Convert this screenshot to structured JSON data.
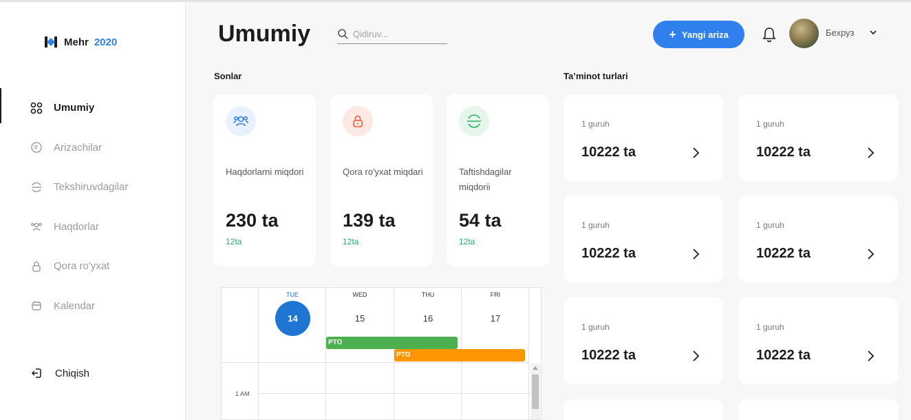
{
  "brand": {
    "name": "Mehr",
    "year": "2020"
  },
  "sidebar": {
    "items": [
      {
        "label": "Umumiy",
        "icon": "grid-icon"
      },
      {
        "label": "Arizachilar",
        "icon": "document-icon"
      },
      {
        "label": "Tekshiruvdagilar",
        "icon": "scan-icon"
      },
      {
        "label": "Haqdorlar",
        "icon": "users-icon"
      },
      {
        "label": "Qora ro'yxat",
        "icon": "lock-icon"
      },
      {
        "label": "Kalendar",
        "icon": "calendar-icon"
      }
    ],
    "logout_label": "Chiqish"
  },
  "header": {
    "title": "Umumiy",
    "search_placeholder": "Qidiruv...",
    "new_button_label": "Yangi ariza",
    "user_name": "Бехруз"
  },
  "stats": {
    "section_label": "Sonlar",
    "cards": [
      {
        "label": "Haqdorlarni miqdori",
        "value": "230 ta",
        "sub": "12ta",
        "icon": "users-icon",
        "icon_color": "#2f80ed",
        "icon_bg": "#e8f1fd"
      },
      {
        "label": "Qora ro'yxat miqdari",
        "value": "139 ta",
        "sub": "12ta",
        "icon": "lock-icon",
        "icon_color": "#eb5a3c",
        "icon_bg": "#fde9e4"
      },
      {
        "label": "Taftishdagilar miqdorii",
        "value": "54 ta",
        "sub": "12ta",
        "icon": "scan-icon",
        "icon_color": "#27ae60",
        "icon_bg": "#e6f6ec"
      }
    ]
  },
  "provisions": {
    "section_label": "Ta’minot turlari",
    "cards": [
      {
        "group": "1 guruh",
        "value": "10222 ta"
      },
      {
        "group": "1 guruh",
        "value": "10222 ta"
      },
      {
        "group": "1 guruh",
        "value": "10222 ta"
      },
      {
        "group": "1 guruh",
        "value": "10222 ta"
      },
      {
        "group": "1 guruh",
        "value": "10222 ta"
      },
      {
        "group": "1 guruh",
        "value": "10222 ta"
      }
    ]
  },
  "calendar": {
    "days": [
      {
        "name": "TUE",
        "date": "14",
        "today": true
      },
      {
        "name": "WED",
        "date": "15"
      },
      {
        "name": "THU",
        "date": "16"
      },
      {
        "name": "FRI",
        "date": "17"
      }
    ],
    "events": [
      {
        "label": "PTO",
        "color": "#4caf50"
      },
      {
        "label": "PTO",
        "color": "#fb9600"
      }
    ],
    "time_label": "1 AM"
  }
}
